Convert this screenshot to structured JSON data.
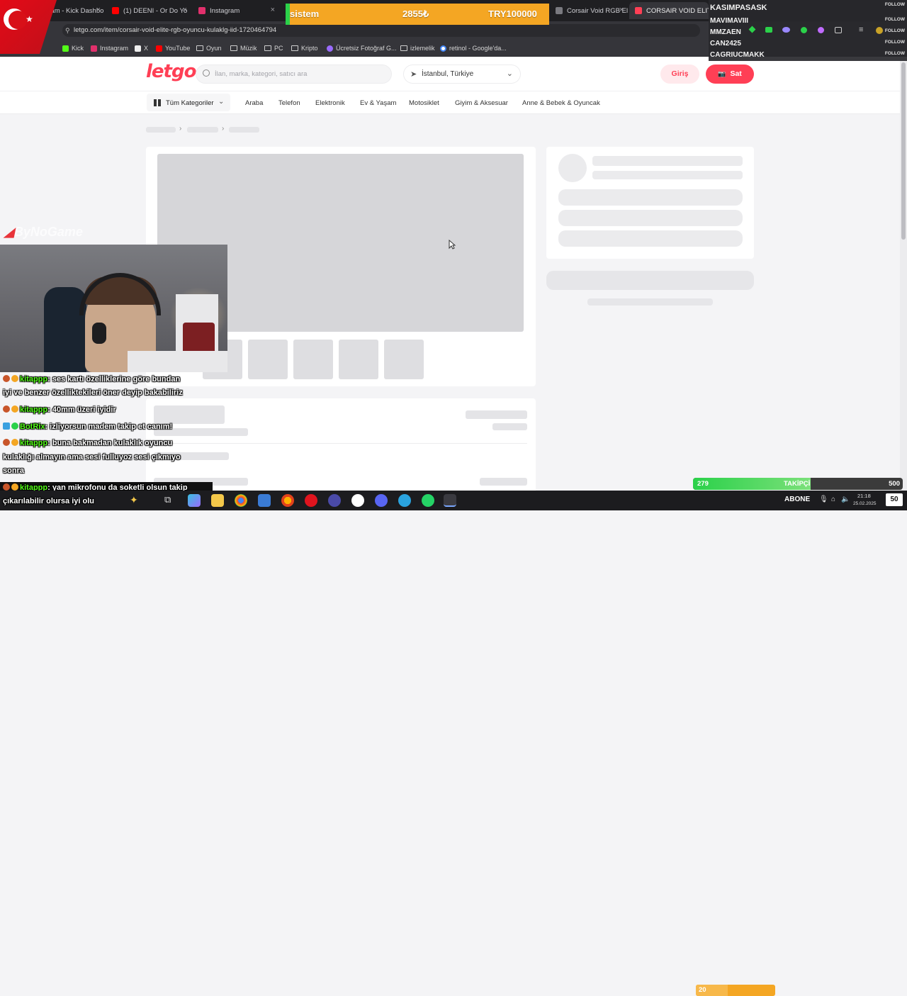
{
  "browser": {
    "tabs": [
      {
        "label": "Stream - Kick Dashbo",
        "color": "#53fc18"
      },
      {
        "label": "(1) DEENI - Or Do Yo",
        "color": "#ff0000"
      },
      {
        "label": "Instagram",
        "color": "#e1306c"
      },
      {
        "label": "Corsair Void RGB Elit",
        "color": "#7a7a80"
      },
      {
        "label": "CORSAIR VOID ELITE",
        "color": "#ff3f55"
      }
    ],
    "url": "letgo.com/item/corsair-void-elite-rgb-oyuncu-kulaklg-iid-1720464794",
    "bookmarks": [
      {
        "label": "Kick",
        "icon": "kick-icon"
      },
      {
        "label": "Instagram",
        "icon": "instagram-icon"
      },
      {
        "label": "X",
        "icon": "x-icon"
      },
      {
        "label": "YouTube",
        "icon": "youtube-icon"
      },
      {
        "label": "Oyun",
        "icon": "folder-icon"
      },
      {
        "label": "Müzik",
        "icon": "folder-icon"
      },
      {
        "label": "PC",
        "icon": "folder-icon"
      },
      {
        "label": "Kripto",
        "icon": "folder-icon"
      },
      {
        "label": "Ücretsiz Fotoğraf G...",
        "icon": "photo-icon"
      },
      {
        "label": "izlemelik",
        "icon": "folder-icon"
      },
      {
        "label": "retinol - Google'da...",
        "icon": "google-icon"
      }
    ]
  },
  "site": {
    "logo": "letgo",
    "search_placeholder": "İlan, marka, kategori, satıcı ara",
    "location": "İstanbul, Türkiye",
    "login": "Giriş",
    "sell": "Sat",
    "categories_button": "Tüm Kategoriler",
    "categories": [
      "Araba",
      "Telefon",
      "Elektronik",
      "Ev & Yaşam",
      "Motosiklet",
      "Giyim & Aksesuar",
      "Anne & Bebek & Oyuncak"
    ],
    "accent": "#ff3f55"
  },
  "stream": {
    "donation": {
      "name": "sistem",
      "amount": "2855₺",
      "goal": "TRY100000"
    },
    "followers": [
      "KASIMPASASK",
      "MAVIMAVIII",
      "MMZAEN",
      "CAN2425",
      "CAGRIUCMAKK"
    ],
    "follow_tag": "FOLLOW",
    "watermark": "ByNoGame",
    "chat": [
      {
        "user": "kitappp",
        "text": ": ses kartı özelliklerine göre bundan"
      },
      {
        "user": "",
        "text": "iyi ve benzer özelliktekileri öner deyip bakabiliriz"
      },
      {
        "user": "kitappp",
        "text": ": 40mm üzeri iyidir"
      },
      {
        "user": "BotRix",
        "text": ": izliyorsun madem takip et canım!"
      },
      {
        "user": "kitappp",
        "text": ": buna bakmadan kulaklık oyuncu"
      },
      {
        "user": "",
        "text": "kulaklığı almayın ama sesi fulluyoz sesi çıkmıyo"
      },
      {
        "user": "",
        "text": "sonra"
      },
      {
        "user": "kitappp",
        "text": ": yan mikrofonu da soketli olsun takip"
      },
      {
        "user": "",
        "text": "çıkarılabilir olursa iyi olu"
      }
    ],
    "follower_goal": {
      "current": "279",
      "label": "TAKİPÇİ",
      "target": "500",
      "progress": 0.56
    },
    "sub_goal": {
      "current": "20",
      "label": "ABONE",
      "target": "50",
      "progress": 0.4
    }
  },
  "taskbar": {
    "time": "21:18",
    "date": "25.02.2025"
  }
}
